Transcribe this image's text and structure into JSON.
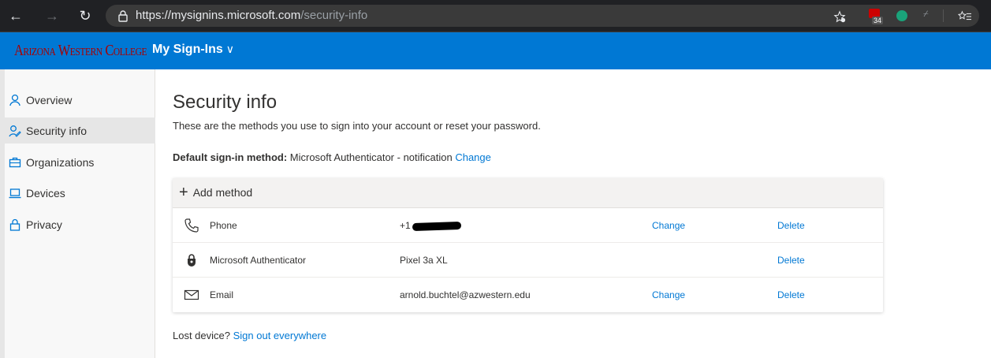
{
  "browser": {
    "url_host": "https://mysignins.microsoft.com",
    "url_path": "/security-info",
    "badge_count": "34"
  },
  "app": {
    "org_name": "Arizona Western College",
    "title": "My Sign-Ins",
    "title_chevron": "∨",
    "brand_color": "#0078d4"
  },
  "sidebar": {
    "items": [
      {
        "label": "Overview",
        "icon": "person-icon"
      },
      {
        "label": "Security info",
        "icon": "security-info-icon",
        "active": true
      },
      {
        "label": "Organizations",
        "icon": "briefcase-icon"
      },
      {
        "label": "Devices",
        "icon": "laptop-icon"
      },
      {
        "label": "Privacy",
        "icon": "lock-icon"
      }
    ]
  },
  "main": {
    "title": "Security info",
    "description": "These are the methods you use to sign into your account or reset your password.",
    "default_label": "Default sign-in method:",
    "default_value": " Microsoft Authenticator - notification ",
    "default_change": "Change",
    "add_method": "Add method",
    "methods": [
      {
        "name": "Phone",
        "value": "+1",
        "change": "Change",
        "delete": "Delete",
        "icon": "phone-icon"
      },
      {
        "name": "Microsoft Authenticator",
        "value": "Pixel 3a XL",
        "change": "",
        "delete": "Delete",
        "icon": "authenticator-icon"
      },
      {
        "name": "Email",
        "value": "arnold.buchtel@azwestern.edu",
        "change": "Change",
        "delete": "Delete",
        "icon": "envelope-icon"
      }
    ],
    "lost_device": "Lost device? ",
    "sign_out": "Sign out everywhere"
  }
}
